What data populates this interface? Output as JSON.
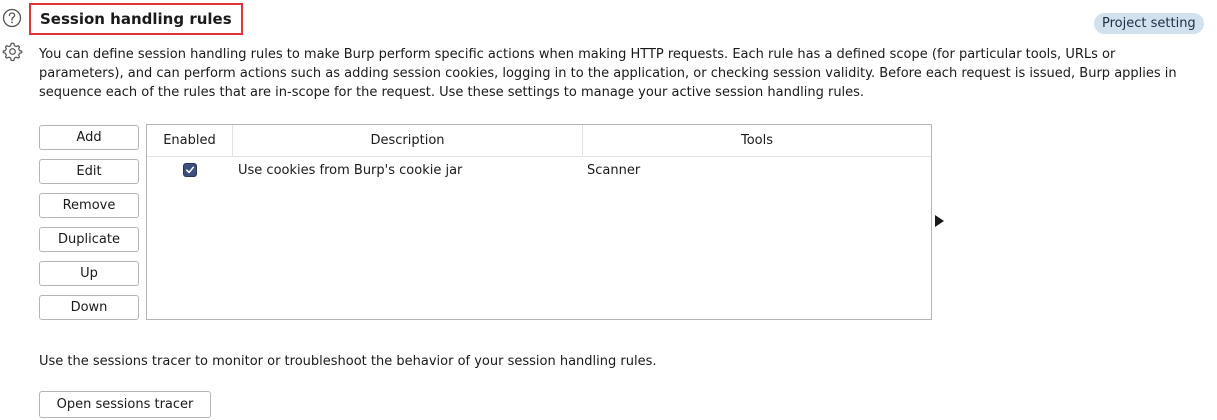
{
  "header": {
    "help_icon": "question-circle-icon",
    "settings_icon": "gear-icon",
    "title": "Session handling rules",
    "badge": "Project setting"
  },
  "description": "You can define session handling rules to make Burp perform specific actions when making HTTP requests. Each rule has a defined scope (for particular tools, URLs or parameters), and can perform actions such as adding session cookies, logging in to the application, or checking session validity. Before each request is issued, Burp applies in sequence each of the rules that are in-scope for the request. Use these settings to manage your active session handling rules.",
  "buttons": {
    "add": "Add",
    "edit": "Edit",
    "remove": "Remove",
    "duplicate": "Duplicate",
    "up": "Up",
    "down": "Down"
  },
  "table": {
    "columns": [
      "Enabled",
      "Description",
      "Tools"
    ],
    "rows": [
      {
        "enabled": true,
        "description": "Use cookies from Burp's cookie jar",
        "tools": "Scanner"
      }
    ]
  },
  "expand_icon": "triangle-right-icon",
  "tracer": {
    "text": "Use the sessions tracer to monitor or troubleshoot the behavior of your session handling rules.",
    "button": "Open sessions tracer"
  },
  "colors": {
    "title_border": "#e0333a",
    "badge_bg": "#d2e1ee",
    "checkbox": "#3d4f7a"
  }
}
